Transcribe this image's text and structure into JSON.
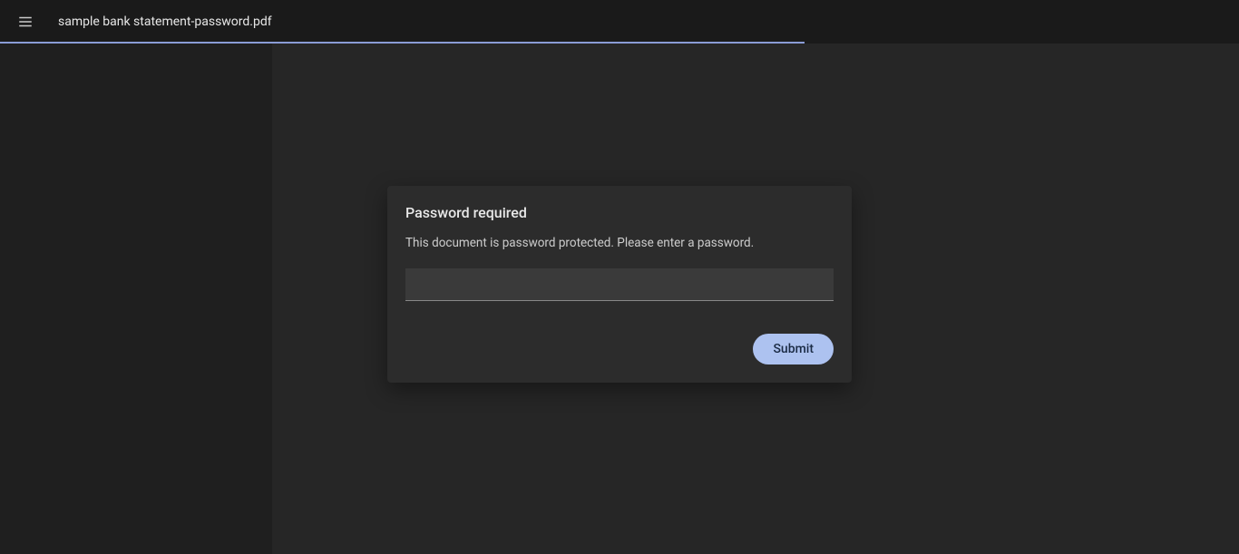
{
  "header": {
    "filename": "sample bank statement-password.pdf"
  },
  "dialog": {
    "title": "Password required",
    "message": "This document is password protected. Please enter a password.",
    "submit_label": "Submit",
    "password_value": ""
  }
}
